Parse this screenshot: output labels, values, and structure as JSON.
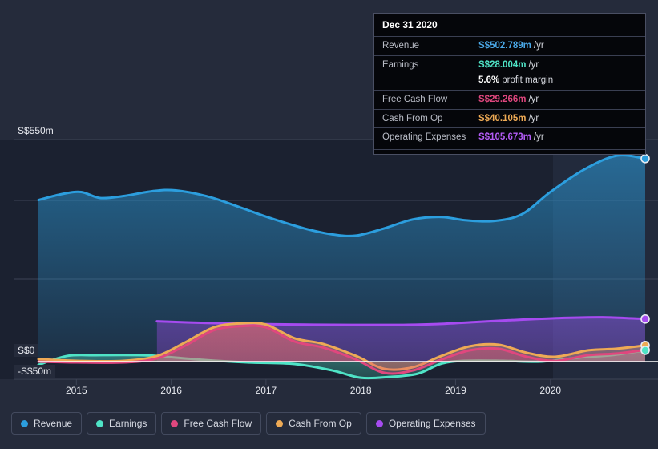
{
  "chart_data": {
    "type": "area",
    "title": "",
    "currency_prefix": "S$",
    "xlabel": "",
    "ylabel": "",
    "x_tick_labels": [
      "2015",
      "2016",
      "2017",
      "2018",
      "2019",
      "2020"
    ],
    "y_tick_labels": [
      "S$550m",
      "S$0",
      "-S$50m"
    ],
    "ylim": [
      -50,
      550
    ],
    "grid": true,
    "legend_position": "bottom-left",
    "forecast_shading_from": "2020",
    "series": [
      {
        "name": "Revenue",
        "color": "#2c9ede",
        "latest_value": 502.789,
        "points": [
          {
            "x": 2014.6,
            "y": 400
          },
          {
            "x": 2014.85,
            "y": 415
          },
          {
            "x": 2015.05,
            "y": 420
          },
          {
            "x": 2015.25,
            "y": 405
          },
          {
            "x": 2015.5,
            "y": 410
          },
          {
            "x": 2015.8,
            "y": 422
          },
          {
            "x": 2016.05,
            "y": 424
          },
          {
            "x": 2016.4,
            "y": 408
          },
          {
            "x": 2016.75,
            "y": 380
          },
          {
            "x": 2017.05,
            "y": 355
          },
          {
            "x": 2017.4,
            "y": 330
          },
          {
            "x": 2017.7,
            "y": 315
          },
          {
            "x": 2017.95,
            "y": 312
          },
          {
            "x": 2018.25,
            "y": 330
          },
          {
            "x": 2018.55,
            "y": 352
          },
          {
            "x": 2018.85,
            "y": 358
          },
          {
            "x": 2019.1,
            "y": 350
          },
          {
            "x": 2019.4,
            "y": 348
          },
          {
            "x": 2019.7,
            "y": 365
          },
          {
            "x": 2020.0,
            "y": 420
          },
          {
            "x": 2020.35,
            "y": 475
          },
          {
            "x": 2020.7,
            "y": 510
          },
          {
            "x": 2021.0,
            "y": 502.789
          }
        ]
      },
      {
        "name": "Earnings",
        "color": "#4fe3c6",
        "latest_value": 28.004,
        "profit_margin": "5.6%",
        "points": [
          {
            "x": 2014.6,
            "y": -8
          },
          {
            "x": 2014.9,
            "y": 14
          },
          {
            "x": 2015.2,
            "y": 16
          },
          {
            "x": 2015.7,
            "y": 16
          },
          {
            "x": 2015.95,
            "y": 12
          },
          {
            "x": 2016.3,
            "y": 5
          },
          {
            "x": 2016.8,
            "y": -2
          },
          {
            "x": 2017.3,
            "y": -6
          },
          {
            "x": 2017.7,
            "y": -22
          },
          {
            "x": 2018.0,
            "y": -40
          },
          {
            "x": 2018.3,
            "y": -38
          },
          {
            "x": 2018.6,
            "y": -30
          },
          {
            "x": 2018.85,
            "y": -5
          },
          {
            "x": 2019.1,
            "y": 2
          },
          {
            "x": 2019.5,
            "y": 2
          },
          {
            "x": 2019.9,
            "y": 0
          },
          {
            "x": 2020.3,
            "y": 10
          },
          {
            "x": 2020.65,
            "y": 16
          },
          {
            "x": 2021.0,
            "y": 28.004
          }
        ]
      },
      {
        "name": "Free Cash Flow",
        "color": "#e0477e",
        "latest_value": 29.266,
        "points": [
          {
            "x": 2014.6,
            "y": 0
          },
          {
            "x": 2015.0,
            "y": -2
          },
          {
            "x": 2015.5,
            "y": -2
          },
          {
            "x": 2015.85,
            "y": 8
          },
          {
            "x": 2016.15,
            "y": 40
          },
          {
            "x": 2016.45,
            "y": 78
          },
          {
            "x": 2016.75,
            "y": 88
          },
          {
            "x": 2017.0,
            "y": 85
          },
          {
            "x": 2017.3,
            "y": 50
          },
          {
            "x": 2017.6,
            "y": 35
          },
          {
            "x": 2017.95,
            "y": 5
          },
          {
            "x": 2018.25,
            "y": -28
          },
          {
            "x": 2018.55,
            "y": -22
          },
          {
            "x": 2018.85,
            "y": 5
          },
          {
            "x": 2019.15,
            "y": 28
          },
          {
            "x": 2019.45,
            "y": 32
          },
          {
            "x": 2019.75,
            "y": 12
          },
          {
            "x": 2020.05,
            "y": 2
          },
          {
            "x": 2020.4,
            "y": 16
          },
          {
            "x": 2020.7,
            "y": 20
          },
          {
            "x": 2021.0,
            "y": 29.266
          }
        ]
      },
      {
        "name": "Cash From Op",
        "color": "#eeaa55",
        "latest_value": 40.105,
        "points": [
          {
            "x": 2014.6,
            "y": 6
          },
          {
            "x": 2015.0,
            "y": 2
          },
          {
            "x": 2015.5,
            "y": 2
          },
          {
            "x": 2015.85,
            "y": 14
          },
          {
            "x": 2016.15,
            "y": 48
          },
          {
            "x": 2016.45,
            "y": 85
          },
          {
            "x": 2016.75,
            "y": 95
          },
          {
            "x": 2017.0,
            "y": 92
          },
          {
            "x": 2017.3,
            "y": 58
          },
          {
            "x": 2017.6,
            "y": 44
          },
          {
            "x": 2017.95,
            "y": 14
          },
          {
            "x": 2018.25,
            "y": -18
          },
          {
            "x": 2018.55,
            "y": -14
          },
          {
            "x": 2018.85,
            "y": 14
          },
          {
            "x": 2019.15,
            "y": 38
          },
          {
            "x": 2019.45,
            "y": 42
          },
          {
            "x": 2019.75,
            "y": 22
          },
          {
            "x": 2020.05,
            "y": 12
          },
          {
            "x": 2020.4,
            "y": 28
          },
          {
            "x": 2020.7,
            "y": 32
          },
          {
            "x": 2021.0,
            "y": 40.105
          }
        ]
      },
      {
        "name": "Operating Expenses",
        "color": "#a64bf0",
        "latest_value": 105.673,
        "points": [
          {
            "x": 2015.85,
            "y": 100
          },
          {
            "x": 2016.2,
            "y": 97
          },
          {
            "x": 2016.7,
            "y": 94
          },
          {
            "x": 2017.3,
            "y": 92
          },
          {
            "x": 2017.9,
            "y": 91
          },
          {
            "x": 2018.4,
            "y": 91
          },
          {
            "x": 2018.8,
            "y": 93
          },
          {
            "x": 2019.2,
            "y": 98
          },
          {
            "x": 2019.6,
            "y": 103
          },
          {
            "x": 2020.1,
            "y": 108
          },
          {
            "x": 2020.55,
            "y": 110
          },
          {
            "x": 2021.0,
            "y": 105.673
          }
        ]
      }
    ]
  },
  "tooltip": {
    "title": "Dec 31 2020",
    "rows": [
      {
        "label": "Revenue",
        "value": "S$502.789m",
        "unit": "/yr",
        "color": "#4aa8e8"
      },
      {
        "label": "Earnings",
        "value": "S$28.004m",
        "unit": "/yr",
        "color": "#4fe3c6"
      },
      {
        "label": "",
        "value": "5.6%",
        "unit": "profit margin",
        "color": "#ffffff"
      },
      {
        "label": "Free Cash Flow",
        "value": "S$29.266m",
        "unit": "/yr",
        "color": "#e0477e"
      },
      {
        "label": "Cash From Op",
        "value": "S$40.105m",
        "unit": "/yr",
        "color": "#eeaa55"
      },
      {
        "label": "Operating Expenses",
        "value": "S$105.673m",
        "unit": "/yr",
        "color": "#b35cf5"
      }
    ]
  },
  "axes": {
    "y_top_label": "S$550m",
    "y_zero_label": "S$0",
    "y_bottom_label": "-S$50m",
    "x_labels": [
      "2015",
      "2016",
      "2017",
      "2018",
      "2019",
      "2020"
    ]
  },
  "legend": {
    "items": [
      {
        "label": "Revenue",
        "color": "#2c9ede"
      },
      {
        "label": "Earnings",
        "color": "#4fe3c6"
      },
      {
        "label": "Free Cash Flow",
        "color": "#e0477e"
      },
      {
        "label": "Cash From Op",
        "color": "#eeaa55"
      },
      {
        "label": "Operating Expenses",
        "color": "#a64bf0"
      }
    ]
  },
  "theme": {
    "background": "#252b3b",
    "plot_background": "#1b2130",
    "gridline": "#3d4456",
    "zero_line": "#ffffff"
  }
}
